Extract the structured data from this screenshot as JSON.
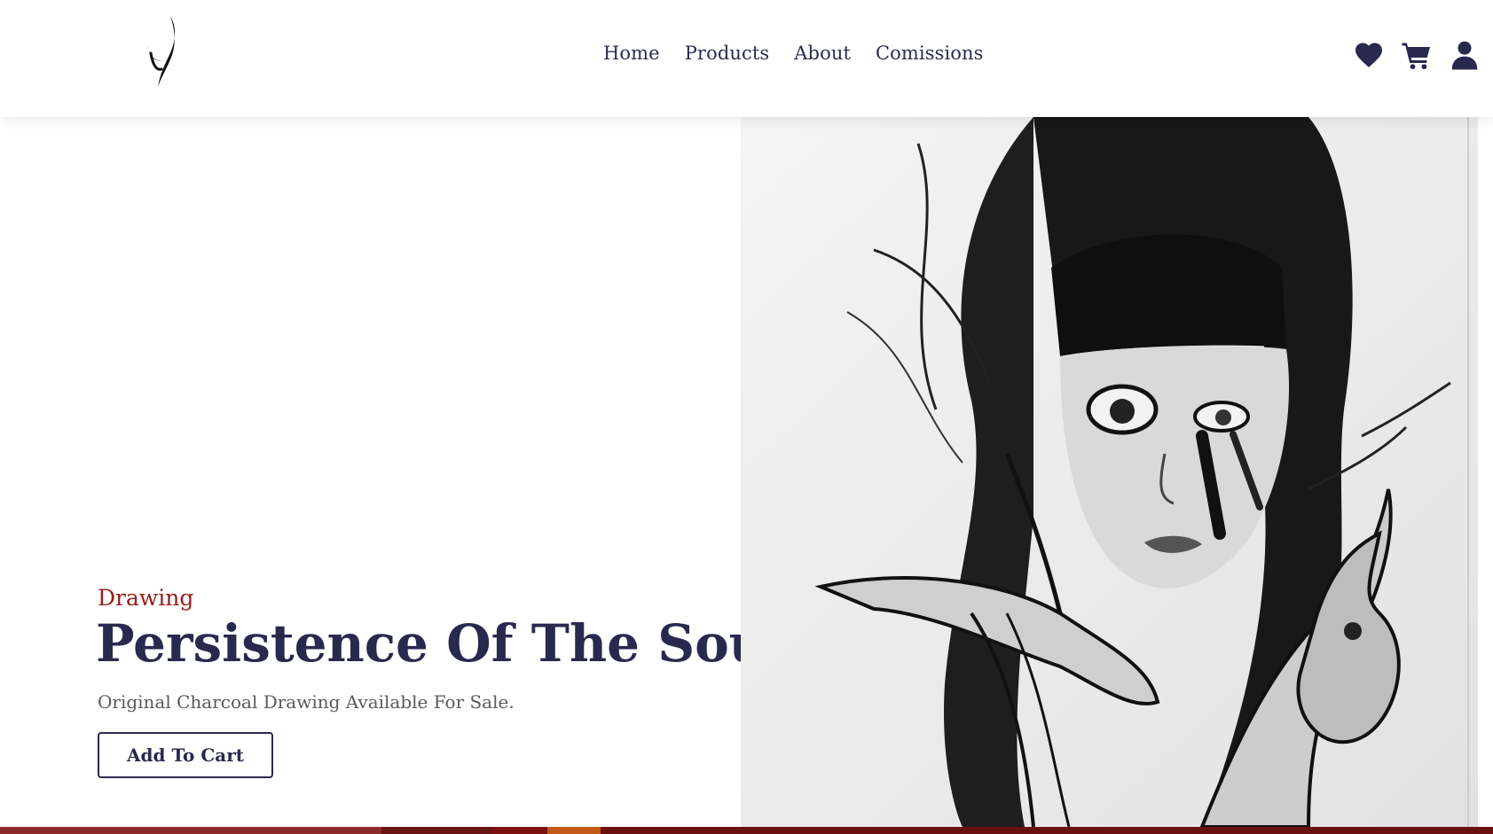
{
  "header": {
    "nav": [
      {
        "label": "Home"
      },
      {
        "label": "Products"
      },
      {
        "label": "About"
      },
      {
        "label": "Comissions"
      }
    ],
    "icons": [
      "heart-icon",
      "cart-icon",
      "user-icon"
    ]
  },
  "hero": {
    "category": "Drawing",
    "title": "Persistence Of The Soul",
    "subtitle": "Original Charcoal Drawing Available For Sale.",
    "button_label": "Add To Cart"
  },
  "colors": {
    "accent_dark": "#29294f",
    "category_red": "#9b1c1c",
    "subtitle_gray": "#5a5a5a",
    "strip": [
      "#8b2a2a",
      "#6a1515",
      "#7a1010",
      "#c45a1a",
      "#6b1010"
    ]
  }
}
